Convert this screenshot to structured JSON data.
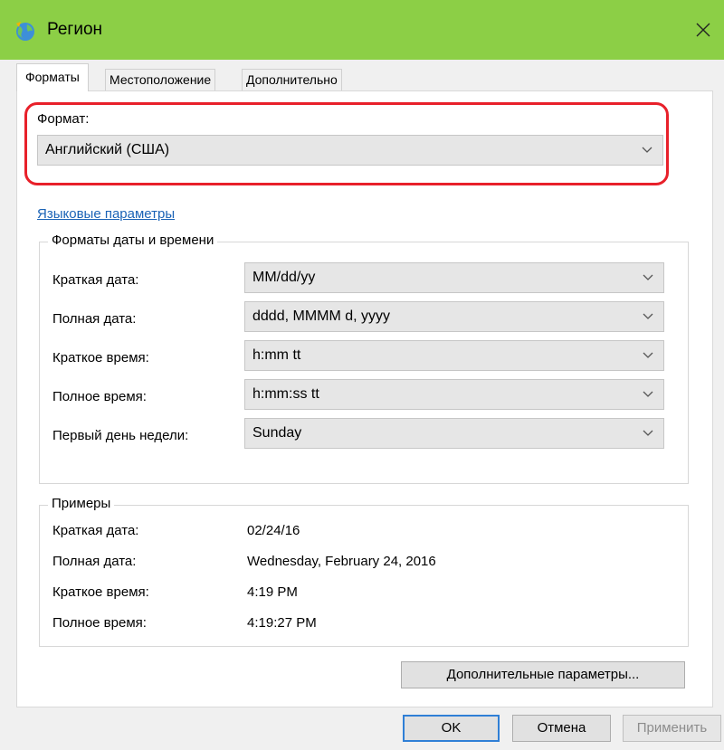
{
  "window": {
    "title": "Регион"
  },
  "tabs": [
    {
      "label": "Форматы",
      "active": true
    },
    {
      "label": "Местоположение",
      "active": false
    },
    {
      "label": "Дополнительно",
      "active": false
    }
  ],
  "format": {
    "label": "Формат:",
    "value": "Английский (США)"
  },
  "language_link": "Языковые параметры",
  "datetime_group": {
    "title": "Форматы даты и времени",
    "rows": [
      {
        "label": "Краткая дата:",
        "value": "MM/dd/yy"
      },
      {
        "label": "Полная дата:",
        "value": "dddd, MMMM d, yyyy"
      },
      {
        "label": "Краткое время:",
        "value": "h:mm tt"
      },
      {
        "label": "Полное время:",
        "value": "h:mm:ss tt"
      },
      {
        "label": "Первый день недели:",
        "value": "Sunday"
      }
    ]
  },
  "examples_group": {
    "title": "Примеры",
    "rows": [
      {
        "label": "Краткая дата:",
        "value": "02/24/16"
      },
      {
        "label": "Полная дата:",
        "value": "Wednesday, February 24, 2016"
      },
      {
        "label": "Краткое время:",
        "value": "4:19 PM"
      },
      {
        "label": "Полное время:",
        "value": "4:19:27 PM"
      }
    ]
  },
  "buttons": {
    "additional": "Дополнительные параметры...",
    "ok": "OK",
    "cancel": "Отмена",
    "apply": "Применить"
  },
  "colors": {
    "titlebar": "#8ccf46",
    "highlight": "#e8202a",
    "link": "#1b63b6",
    "primary_border": "#2f7fd6"
  }
}
